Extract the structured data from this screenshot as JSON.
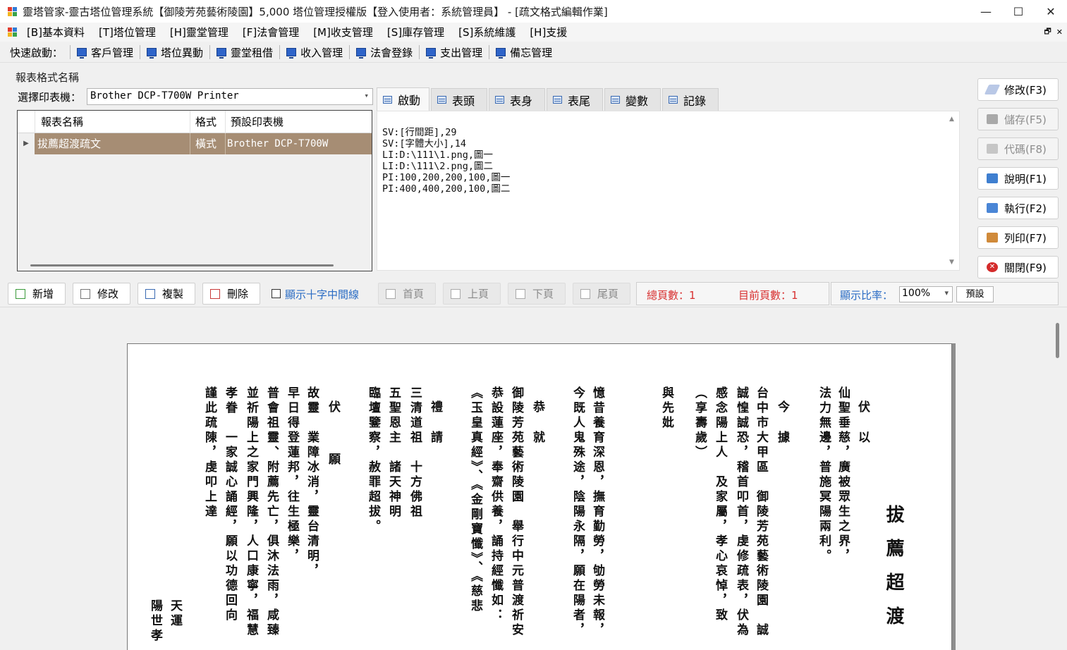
{
  "window": {
    "title": "靈塔管家-靈古塔位管理系統【御陵芳苑藝術陵園】5,000 塔位管理授權版【登入使用者：系統管理員】 - [疏文格式編輯作業]",
    "minimize": "—",
    "maximize": "☐",
    "close": "✕"
  },
  "menu": {
    "items": [
      "[B]基本資料",
      "[T]塔位管理",
      "[H]靈堂管理",
      "[F]法會管理",
      "[M]收支管理",
      "[S]庫存管理",
      "[S]系統維護",
      "[H]支援"
    ],
    "mdi_restore": "🗗",
    "mdi_close": "✕"
  },
  "quickbar": {
    "label": "快速啟動：",
    "items": [
      "客戶管理",
      "塔位異動",
      "靈堂租借",
      "收入管理",
      "法會登錄",
      "支出管理",
      "備忘管理"
    ]
  },
  "report": {
    "group_title": "報表格式名稱",
    "printer_label": "選擇印表機：",
    "printer_value": "Brother DCP-T700W Printer",
    "columns": [
      "報表名稱",
      "格式",
      "預設印表機"
    ],
    "rows": [
      {
        "name": "拔薦超渡疏文",
        "format": "橫式",
        "printer": "Brother DCP-T700W"
      }
    ]
  },
  "editor": {
    "tabs": [
      "啟動",
      "表頭",
      "表身",
      "表尾",
      "變數",
      "記錄"
    ],
    "active_tab": 0,
    "lines": [
      "SV:[行間距],29",
      "SV:[字體大小],14",
      "LI:D:\\111\\1.png,圖一",
      "LI:D:\\111\\2.png,圖二",
      "PI:100,200,200,100,圖一",
      "PI:400,400,200,100,圖二"
    ]
  },
  "side_buttons": [
    {
      "label": "修改(F3)",
      "icon": "eraser-icon",
      "enabled": true
    },
    {
      "label": "儲存(F5)",
      "icon": "floppy-icon",
      "enabled": false
    },
    {
      "label": "代碼(F8)",
      "icon": "code-icon",
      "enabled": false
    },
    {
      "label": "說明(F1)",
      "icon": "book-icon",
      "enabled": true
    },
    {
      "label": "執行(F2)",
      "icon": "run-icon",
      "enabled": true
    },
    {
      "label": "列印(F7)",
      "icon": "printer-icon",
      "enabled": true
    },
    {
      "label": "關閉(F9)",
      "icon": "close-circle-icon",
      "enabled": true
    }
  ],
  "actions": {
    "add": "新增",
    "edit": "修改",
    "copy": "複製",
    "delete": "刪除",
    "show_crosshair": "顯示十字中間線",
    "first": "首頁",
    "prev": "上頁",
    "next": "下頁",
    "last": "尾頁",
    "total_pages": "總頁數：1",
    "current_page": "目前頁數：1",
    "zoom_label": "顯示比率：",
    "zoom_value": "100%",
    "zoom_reset": "預設"
  },
  "preview": {
    "columns": [
      "拔薦超渡",
      "伏以",
      "仙聖垂慈，廣被眾生之界，",
      "法力無邊，普施冥陽兩利。",
      "今據",
      "台中市大甲區　御陵芳苑藝術陵園　誠",
      "誠惶誠恐，稽首叩首，虔修疏表，伏為",
      "感念陽上人　及家屬，孝心哀悼，致",
      "（享壽歲）",
      "與先妣",
      "憶昔養育深恩，撫育勤勞，劬勞未報，",
      "今既人鬼殊途，陰陽永隔，願在陽者，",
      "恭就",
      "御陵芳苑藝術陵園　舉行中元普渡祈安",
      "恭設蓮座，奉齋供養，誦持經懺如：",
      "《玉皇真經》、《金剛寶懺》、《慈悲",
      "禮請",
      "三清道祖　十方佛祖",
      "五聖恩主　諸天神明",
      "臨壇鑒察，赦罪超拔。",
      "伏　願",
      "故靈　業障冰消，靈台清明，",
      "早日得登蓮邦，往生極樂，",
      "普會祖靈、附薦先亡，俱沐法雨，咸臻",
      "並祈陽上之家門興隆，人口康寧，福慧",
      "孝眷　一家誠心誦經，願以功德回向",
      "謹此疏陳，虔叩上達",
      "天運",
      "陽世孝"
    ]
  }
}
